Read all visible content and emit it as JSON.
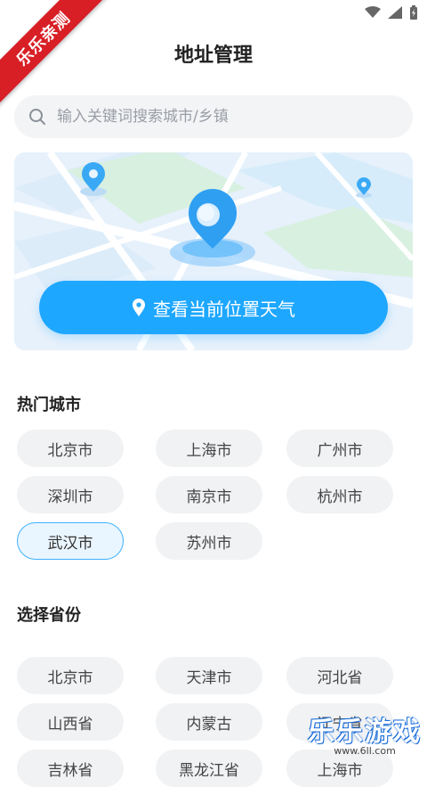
{
  "ribbon": {
    "text": "乐乐亲测"
  },
  "header": {
    "title": "地址管理"
  },
  "search": {
    "placeholder": "输入关键词搜索城市/乡镇"
  },
  "locate": {
    "label": "查看当前位置天气"
  },
  "hot_cities": {
    "title": "热门城市",
    "items": [
      "北京市",
      "上海市",
      "广州市",
      "深圳市",
      "南京市",
      "杭州市",
      "武汉市",
      "苏州市"
    ],
    "selected": "武汉市"
  },
  "provinces": {
    "title": "选择省份",
    "items": [
      "北京市",
      "天津市",
      "河北省",
      "山西省",
      "内蒙古",
      "辽宁省",
      "吉林省",
      "黑龙江省",
      "上海市"
    ]
  },
  "watermark": {
    "brand": "乐乐游戏",
    "url": "www.6ll.com"
  },
  "colors": {
    "accent": "#1ea7ff",
    "ribbon": "#d81f26",
    "chip_bg": "#f1f2f4"
  }
}
